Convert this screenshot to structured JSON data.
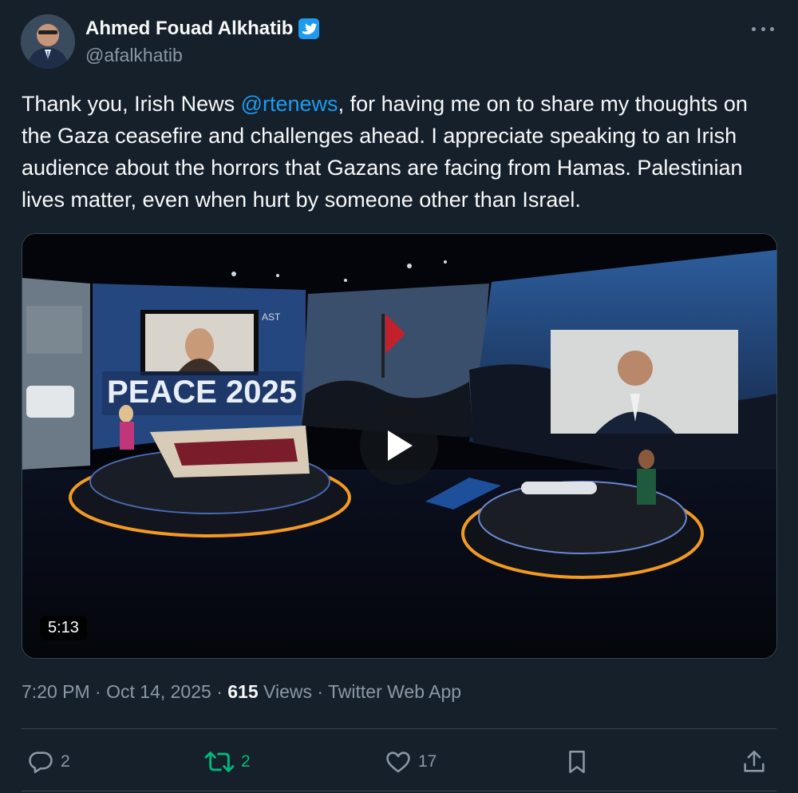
{
  "author": {
    "name": "Ahmed Fouad Alkhatib",
    "handle": "@afalkhatib",
    "verified": true,
    "avatar_icon": "profile-photo"
  },
  "tweet": {
    "text_before": "Thank you, Irish News ",
    "mention": "@rtenews",
    "text_after": ", for having me on to share my thoughts on the Gaza ceasefire and challenges ahead. I appreciate speaking to an Irish audience about the horrors that Gazans are facing from Hamas. Palestinian lives matter, even when hurt by someone other than Israel."
  },
  "video": {
    "duration": "5:13",
    "screen_text": "PEACE 2025",
    "screen_text_small": "AST"
  },
  "meta": {
    "time": "7:20 PM",
    "sep1": " · ",
    "date": "Oct 14, 2025",
    "sep2": " · ",
    "views_count": "615",
    "views_label": " Views",
    "sep3": " · ",
    "source": "Twitter Web App"
  },
  "actions": {
    "replies": "2",
    "retweets": "2",
    "likes": "17"
  },
  "colors": {
    "background": "#15202b",
    "accent": "#1d9bf0",
    "retweet": "#00ba7c",
    "muted": "#8b98a5"
  }
}
